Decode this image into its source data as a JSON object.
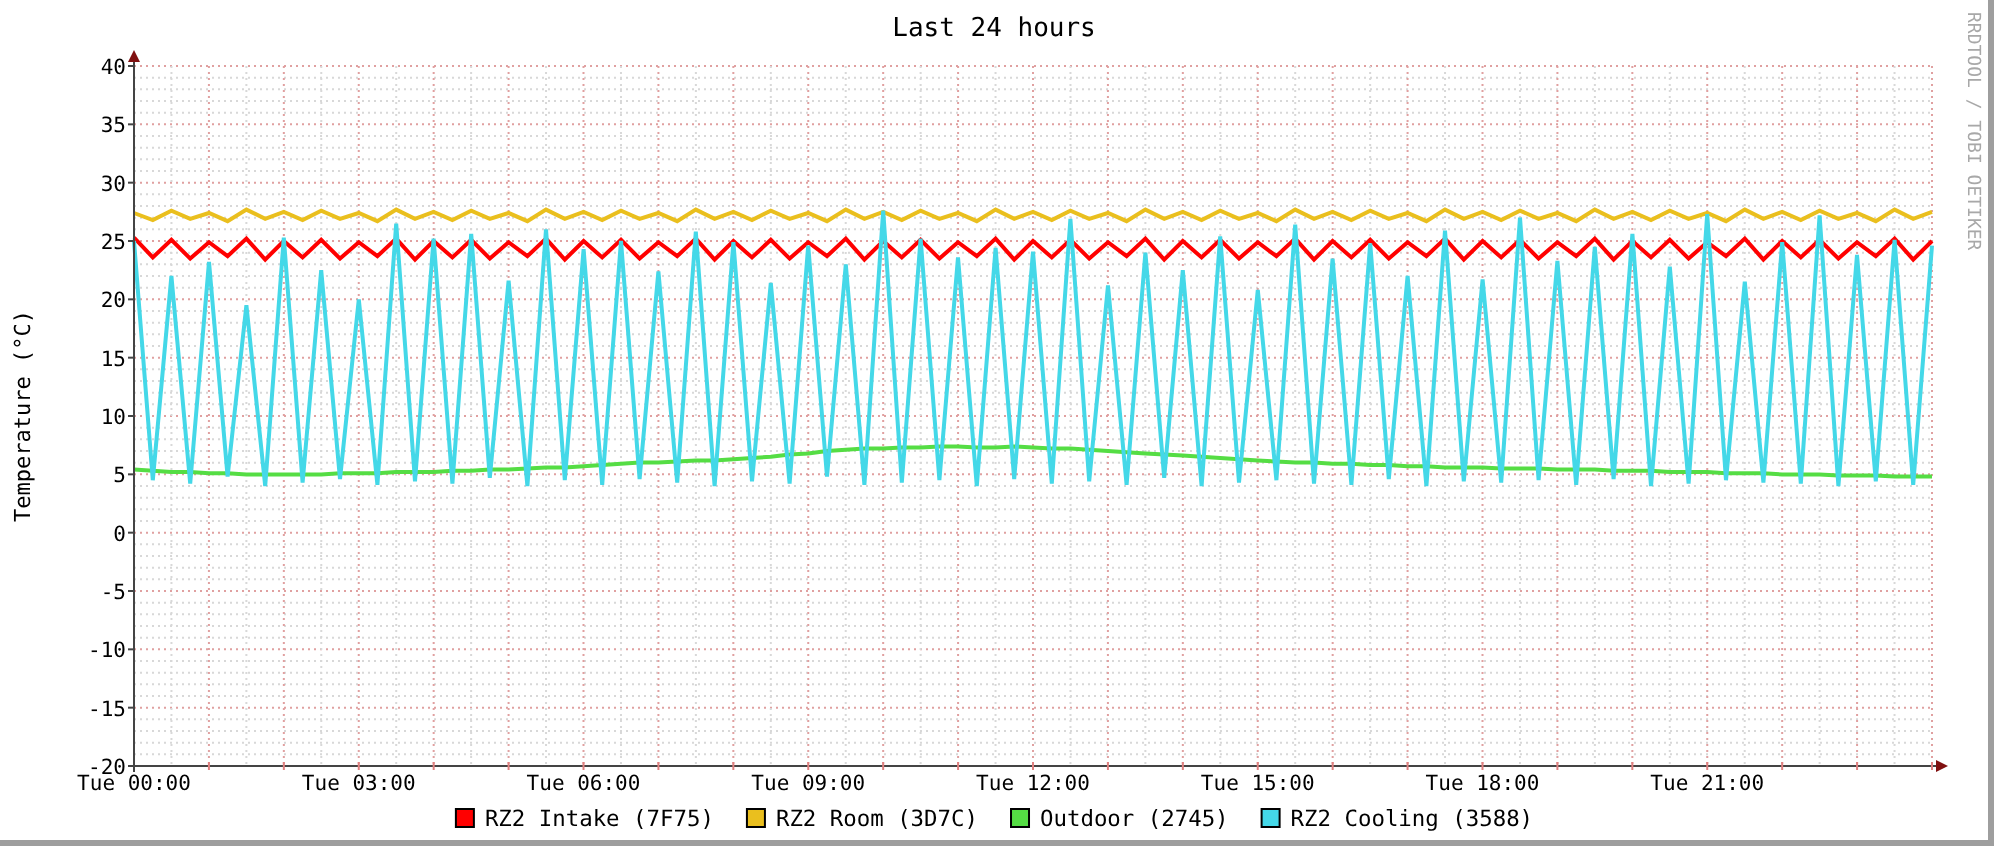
{
  "graph": {
    "side_text": "RRDTOOL / TOBI OETIKER",
    "chart_data": {
      "type": "line",
      "title": "Last 24 hours",
      "ylabel": "Temperature (°C)",
      "categories": [
        "Tue 00:00",
        null,
        null,
        null,
        null,
        null,
        null,
        null,
        null,
        null,
        null,
        null,
        "Tue 03:00",
        null,
        null,
        null,
        null,
        null,
        null,
        null,
        null,
        null,
        null,
        null,
        "Tue 06:00",
        null,
        null,
        null,
        null,
        null,
        null,
        null,
        null,
        null,
        null,
        null,
        "Tue 09:00",
        null,
        null,
        null,
        null,
        null,
        null,
        null,
        null,
        null,
        null,
        null,
        "Tue 12:00",
        null,
        null,
        null,
        null,
        null,
        null,
        null,
        null,
        null,
        null,
        null,
        "Tue 15:00",
        null,
        null,
        null,
        null,
        null,
        null,
        null,
        null,
        null,
        null,
        null,
        "Tue 18:00",
        null,
        null,
        null,
        null,
        null,
        null,
        null,
        null,
        null,
        null,
        null,
        "Tue 21:00",
        null,
        null,
        null,
        null,
        null,
        null,
        null,
        null,
        null,
        null,
        null,
        null
      ],
      "ylim": [
        -20,
        40
      ],
      "grid": true,
      "legend": "bottom",
      "yticks": [
        -20,
        -15,
        -10,
        -5,
        0,
        5,
        10,
        15,
        20,
        25,
        30,
        35,
        40
      ],
      "series": [
        {
          "name": "RZ2 Intake (7F75)",
          "color": "#ff0000",
          "values": [
            25.3,
            23.6,
            25.1,
            23.5,
            24.9,
            23.7,
            25.2,
            23.4,
            25.0,
            23.6,
            25.1,
            23.5,
            24.9,
            23.7,
            25.2,
            23.4,
            25.0,
            23.6,
            25.1,
            23.5,
            24.9,
            23.7,
            25.2,
            23.4,
            25.0,
            23.6,
            25.1,
            23.5,
            24.9,
            23.7,
            25.2,
            23.4,
            25.0,
            23.6,
            25.1,
            23.5,
            24.9,
            23.7,
            25.2,
            23.4,
            25.0,
            23.6,
            25.1,
            23.5,
            24.9,
            23.7,
            25.2,
            23.4,
            25.0,
            23.6,
            25.1,
            23.5,
            24.9,
            23.7,
            25.2,
            23.4,
            25.0,
            23.6,
            25.1,
            23.5,
            24.9,
            23.7,
            25.2,
            23.4,
            25.0,
            23.6,
            25.1,
            23.5,
            24.9,
            23.7,
            25.2,
            23.4,
            25.0,
            23.6,
            25.1,
            23.5,
            24.9,
            23.7,
            25.2,
            23.4,
            25.0,
            23.6,
            25.1,
            23.5,
            24.9,
            23.7,
            25.2,
            23.4,
            25.0,
            23.6,
            25.1,
            23.5,
            24.9,
            23.7,
            25.2,
            23.4,
            25.0
          ]
        },
        {
          "name": "RZ2 Room (3D7C)",
          "color": "#eabf1e",
          "values": [
            27.4,
            26.8,
            27.6,
            26.9,
            27.4,
            26.7,
            27.7,
            26.9,
            27.5,
            26.8,
            27.6,
            26.9,
            27.4,
            26.7,
            27.7,
            26.9,
            27.5,
            26.8,
            27.6,
            26.9,
            27.4,
            26.7,
            27.7,
            26.9,
            27.5,
            26.8,
            27.6,
            26.9,
            27.4,
            26.7,
            27.7,
            26.9,
            27.5,
            26.8,
            27.6,
            26.9,
            27.4,
            26.7,
            27.7,
            26.9,
            27.5,
            26.8,
            27.6,
            26.9,
            27.4,
            26.7,
            27.7,
            26.9,
            27.5,
            26.8,
            27.6,
            26.9,
            27.4,
            26.7,
            27.7,
            26.9,
            27.5,
            26.8,
            27.6,
            26.9,
            27.4,
            26.7,
            27.7,
            26.9,
            27.5,
            26.8,
            27.6,
            26.9,
            27.4,
            26.7,
            27.7,
            26.9,
            27.5,
            26.8,
            27.6,
            26.9,
            27.4,
            26.7,
            27.7,
            26.9,
            27.5,
            26.8,
            27.6,
            26.9,
            27.4,
            26.7,
            27.7,
            26.9,
            27.5,
            26.8,
            27.6,
            26.9,
            27.4,
            26.7,
            27.7,
            26.9,
            27.5
          ]
        },
        {
          "name": "Outdoor (2745)",
          "color": "#55dd44",
          "values": [
            5.4,
            5.3,
            5.2,
            5.2,
            5.1,
            5.1,
            5.0,
            5.0,
            5.0,
            5.0,
            5.0,
            5.1,
            5.1,
            5.1,
            5.2,
            5.2,
            5.2,
            5.3,
            5.3,
            5.4,
            5.4,
            5.5,
            5.6,
            5.6,
            5.7,
            5.8,
            5.9,
            6.0,
            6.0,
            6.1,
            6.2,
            6.2,
            6.3,
            6.4,
            6.5,
            6.7,
            6.8,
            7.0,
            7.1,
            7.2,
            7.2,
            7.3,
            7.3,
            7.4,
            7.4,
            7.3,
            7.3,
            7.4,
            7.3,
            7.2,
            7.2,
            7.1,
            7.0,
            6.9,
            6.8,
            6.7,
            6.6,
            6.5,
            6.4,
            6.3,
            6.2,
            6.1,
            6.0,
            6.0,
            5.9,
            5.9,
            5.8,
            5.8,
            5.7,
            5.7,
            5.6,
            5.6,
            5.6,
            5.5,
            5.5,
            5.5,
            5.4,
            5.4,
            5.4,
            5.3,
            5.3,
            5.3,
            5.2,
            5.2,
            5.2,
            5.1,
            5.1,
            5.1,
            5.0,
            5.0,
            5.0,
            4.9,
            4.9,
            4.9,
            4.8,
            4.8,
            4.8
          ]
        },
        {
          "name": "RZ2 Cooling (3588)",
          "color": "#44d8e8",
          "values": [
            25.0,
            4.5,
            22.0,
            4.2,
            23.2,
            4.8,
            19.5,
            4.0,
            25.3,
            4.3,
            22.5,
            4.6,
            20.0,
            4.1,
            26.5,
            4.4,
            25.2,
            4.2,
            25.6,
            4.7,
            21.6,
            4.0,
            26.0,
            4.5,
            24.3,
            4.1,
            25.0,
            4.6,
            22.4,
            4.3,
            25.8,
            4.0,
            24.9,
            4.4,
            21.4,
            4.2,
            24.6,
            4.8,
            23.0,
            4.1,
            27.6,
            4.3,
            25.2,
            4.5,
            23.6,
            4.0,
            24.4,
            4.6,
            24.1,
            4.2,
            26.9,
            4.4,
            21.2,
            4.1,
            24.0,
            4.7,
            22.5,
            4.0,
            25.4,
            4.3,
            20.8,
            4.5,
            26.4,
            4.2,
            23.5,
            4.1,
            24.8,
            4.6,
            22.0,
            4.0,
            25.9,
            4.4,
            21.7,
            4.3,
            27.0,
            4.5,
            23.3,
            4.1,
            24.5,
            4.6,
            25.6,
            4.0,
            22.8,
            4.2,
            27.3,
            4.5,
            21.5,
            4.3,
            24.9,
            4.2,
            27.2,
            4.0,
            23.8,
            4.4,
            25.1,
            4.1,
            24.6
          ]
        }
      ]
    }
  }
}
